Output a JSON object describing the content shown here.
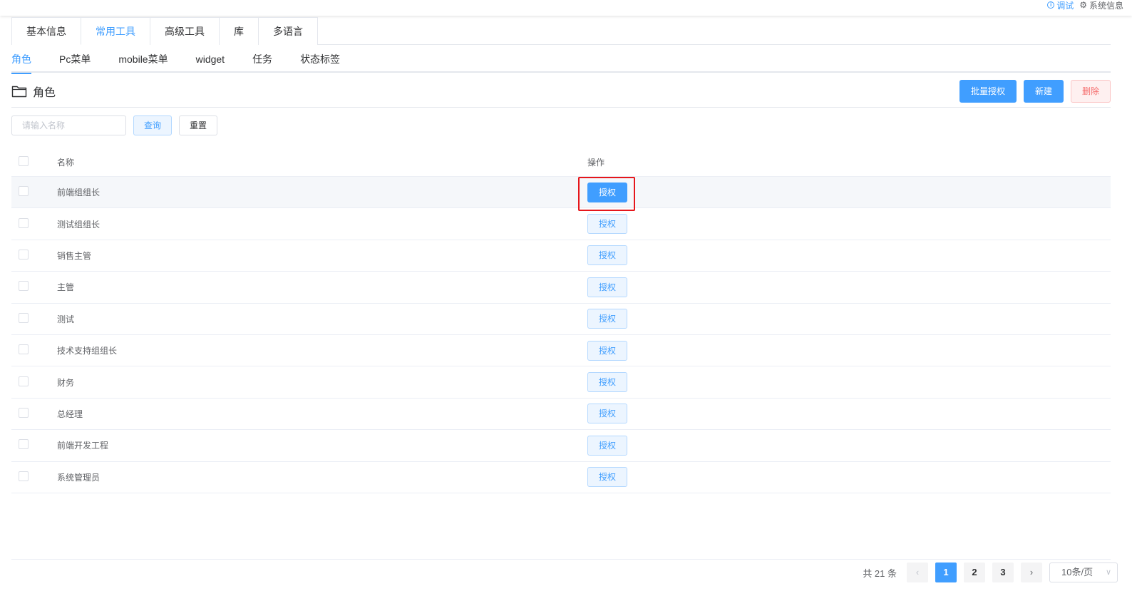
{
  "topbar": {
    "debug_label": "调试",
    "sysinfo_label": "系统信息"
  },
  "main_tabs": [
    {
      "label": "基本信息",
      "active": false
    },
    {
      "label": "常用工具",
      "active": true
    },
    {
      "label": "高级工具",
      "active": false
    },
    {
      "label": "库",
      "active": false
    },
    {
      "label": "多语言",
      "active": false
    }
  ],
  "sub_tabs": [
    {
      "label": "角色",
      "active": true
    },
    {
      "label": "Pc菜单",
      "active": false
    },
    {
      "label": "mobile菜单",
      "active": false
    },
    {
      "label": "widget",
      "active": false
    },
    {
      "label": "任务",
      "active": false
    },
    {
      "label": "状态标签",
      "active": false
    }
  ],
  "page": {
    "title": "角色",
    "buttons": {
      "batch_auth": "批量授权",
      "create": "新建",
      "delete": "删除"
    }
  },
  "search": {
    "placeholder": "请输入名称",
    "value": "",
    "query_label": "查询",
    "reset_label": "重置"
  },
  "table": {
    "columns": {
      "name": "名称",
      "op": "操作"
    },
    "op_label": "授权",
    "rows": [
      {
        "name": "前端组组长"
      },
      {
        "name": "测试组组长"
      },
      {
        "name": "销售主管"
      },
      {
        "name": "主管"
      },
      {
        "name": "测试"
      },
      {
        "name": "技术支持组组长"
      },
      {
        "name": "财务"
      },
      {
        "name": "总经理"
      },
      {
        "name": "前端开发工程"
      },
      {
        "name": "系统管理员"
      }
    ]
  },
  "pagination": {
    "total_text": "共 21 条",
    "pages": [
      "1",
      "2",
      "3"
    ],
    "current": "1",
    "page_size": "10条/页"
  },
  "colors": {
    "primary": "#409eff",
    "danger": "#f56c6c",
    "highlight": "#e6161b"
  }
}
